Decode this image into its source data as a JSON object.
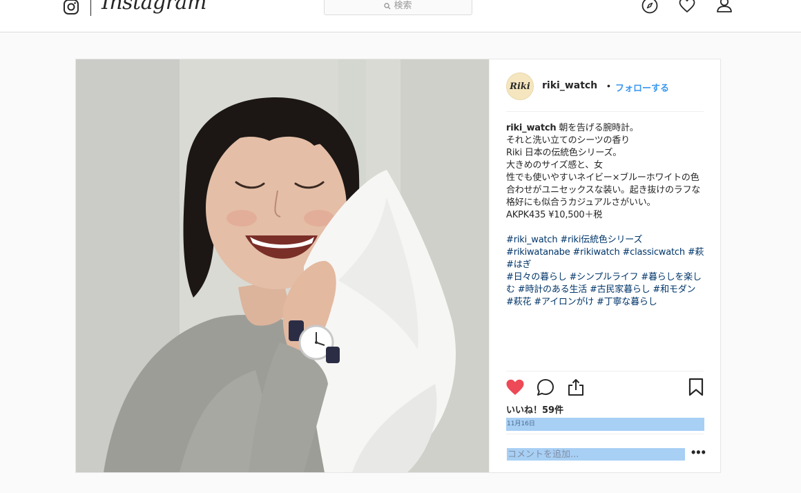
{
  "nav": {
    "brand": "Instagram",
    "search_placeholder": "検索"
  },
  "post": {
    "avatar_text": "Riki",
    "username": "riki_watch",
    "separator": "•",
    "follow_label": "フォローする",
    "caption": {
      "author": "riki_watch",
      "lines": [
        "朝を告げる腕時計。",
        "それと洗い立てのシーツの香り",
        "Riki 日本の伝統色シリーズ。",
        "大きめのサイズ感と、女",
        "性でも使いやすいネイビー×ブルーホワイトの色",
        "合わせがユニセックスな装い。起き抜けのラフな",
        "格好にも似合うカジュアルさがいい。",
        "AKPK435 ¥10,500＋税"
      ],
      "tags": [
        "#riki_watch",
        "#riki伝統色シリーズ",
        "#rikiwatanabe",
        "#rikiwatch",
        "#classicwatch",
        "#萩",
        "#はぎ",
        "#日々の暮らし",
        "#シンプルライフ",
        "#暮らしを楽しむ",
        "#時計のある生活",
        "#古民家暮らし",
        "#和モダン",
        "#萩花",
        "#アイロンがけ",
        "#丁寧な暮らし"
      ]
    },
    "likes_text": "いいね！59件",
    "date": "11月16日",
    "comment_placeholder": "コメントを追加...",
    "more_label": "•••"
  },
  "colors": {
    "accent": "#3897f0",
    "like": "#ed4956",
    "tag": "#003569",
    "highlight": "#a8cff4"
  }
}
